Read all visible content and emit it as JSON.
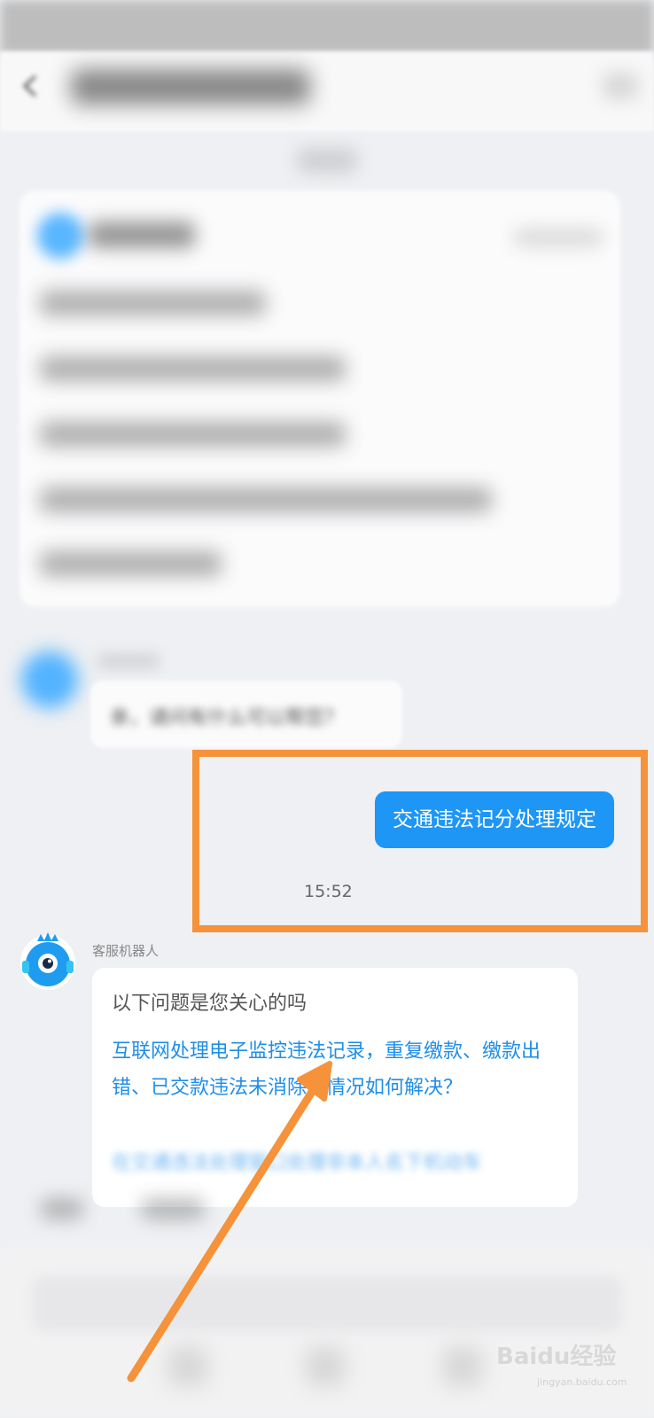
{
  "chat": {
    "user_message": "交通违法记分处理规定",
    "message_time": "15:52",
    "bot_name": "客服机器人",
    "answer": {
      "intro": "以下问题是您关心的吗",
      "question_1": "互联网处理电子监控违法记录，重复缴款、缴款出错、已交款违法未消除等情况如何解决？",
      "question_2_partial": "在交通违法处理窗口处理非本人名下机动车"
    },
    "greeting_partial": "亲，请问有什么可以帮您？"
  },
  "watermark": {
    "text": "Baidu经验",
    "sub": "jingyan.baidu.com"
  },
  "colors": {
    "user_bubble": "#1e96f5",
    "link_text": "#1f8ee8",
    "highlight_box": "#f5923a",
    "annotation_arrow": "#f5923a"
  },
  "icons": {
    "robot_avatar": "robot-avatar-icon",
    "back": "back-arrow-icon",
    "annotation": "arrow-icon"
  }
}
